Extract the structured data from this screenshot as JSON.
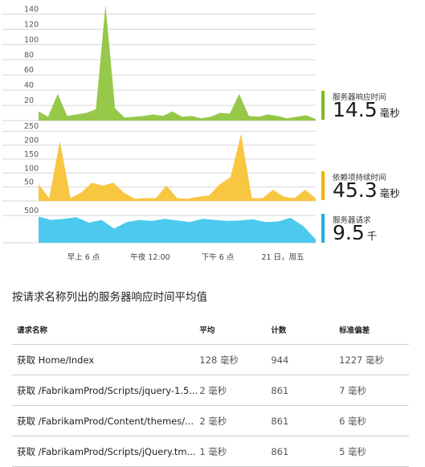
{
  "chart_data": {
    "type": "area",
    "x_tick_labels": [
      "早上 6 点",
      "午夜 12:00",
      "下午 6 点",
      "21 日，周五"
    ],
    "panels": [
      {
        "name": "服务器响应时间",
        "color": "#96c84a",
        "y_ticks": [
          20,
          40,
          60,
          80,
          100,
          120,
          140
        ],
        "ylim": [
          0,
          150
        ],
        "values": [
          12,
          5,
          35,
          6,
          8,
          10,
          15,
          152,
          16,
          4,
          5,
          6,
          8,
          6,
          12,
          5,
          6,
          3,
          5,
          10,
          9,
          35,
          6,
          5,
          8,
          6,
          3,
          5,
          7,
          2
        ]
      },
      {
        "name": "依赖项持续时间",
        "color": "#f9c642",
        "y_ticks": [
          50,
          100,
          150,
          200,
          250
        ],
        "ylim": [
          0,
          265
        ],
        "values": [
          60,
          10,
          215,
          10,
          30,
          65,
          55,
          65,
          30,
          8,
          10,
          10,
          55,
          10,
          8,
          15,
          20,
          60,
          85,
          240,
          10,
          10,
          40,
          15,
          10,
          40,
          10
        ]
      },
      {
        "name": "服务器请求",
        "color": "#4dc9ee",
        "y_ticks": [
          500
        ],
        "ylim": [
          0,
          650
        ],
        "values": [
          480,
          420,
          440,
          470,
          370,
          420,
          260,
          380,
          420,
          400,
          440,
          410,
          380,
          440,
          420,
          400,
          410,
          430,
          380,
          390,
          460,
          310,
          60
        ]
      }
    ],
    "kpis": [
      {
        "label": "服务器响应时间",
        "value": "14.5",
        "unit": "毫秒",
        "color": "#7dbb1e"
      },
      {
        "label": "依赖项持续时间",
        "value": "45.3",
        "unit": "毫秒",
        "color": "#f2b400"
      },
      {
        "label": "服务器请求",
        "value": "9.5",
        "unit": "千",
        "color": "#1bb0e6"
      }
    ]
  },
  "section_title": "按请求名称列出的服务器响应时间平均值",
  "table": {
    "headers": [
      "请求名称",
      "平均",
      "计数",
      "标准偏差"
    ],
    "rows": [
      [
        "获取 Home/Index",
        "128 毫秒",
        "944",
        "1227 毫秒"
      ],
      [
        "获取 /FabrikamProd/Scripts/jquery-1.5...",
        "2 毫秒",
        "861",
        "7 毫秒"
      ],
      [
        "获取 /FabrikamProd/Content/themes/...",
        "2 毫秒",
        "861",
        "6 毫秒"
      ],
      [
        "获取 /FabrikamProd/Scripts/jQuery.tm...",
        "1 毫秒",
        "861",
        "5 毫秒"
      ]
    ]
  }
}
